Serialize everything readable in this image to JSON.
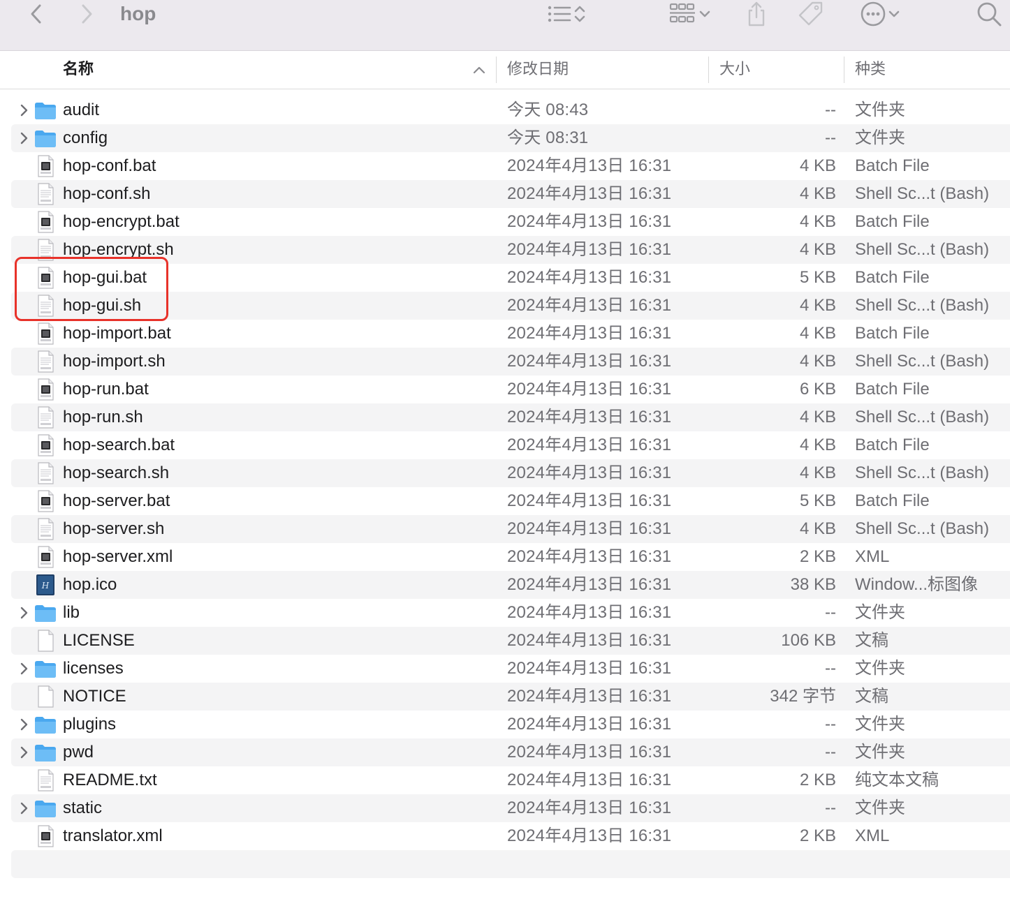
{
  "window": {
    "title": "hop"
  },
  "toolbar": {
    "icons": [
      "chevron-left-icon",
      "chevron-right-icon",
      "list-view-icon",
      "sort-updown-icon",
      "grid-view-icon",
      "chevron-down-icon",
      "share-icon",
      "tag-icon",
      "more-icon",
      "chevron-down-icon",
      "search-icon"
    ]
  },
  "columns": {
    "name": "名称",
    "date": "修改日期",
    "size": "大小",
    "kind": "种类"
  },
  "highlight_color": "#e8322a",
  "folder_color": "#4aa8ef",
  "files": [
    {
      "name": "audit",
      "date": "今天 08:43",
      "size": "--",
      "kind": "文件夹",
      "type": "folder"
    },
    {
      "name": "config",
      "date": "今天 08:31",
      "size": "--",
      "kind": "文件夹",
      "type": "folder"
    },
    {
      "name": "hop-conf.bat",
      "date": "2024年4月13日 16:31",
      "size": "4 KB",
      "kind": "Batch File",
      "type": "batch"
    },
    {
      "name": "hop-conf.sh",
      "date": "2024年4月13日 16:31",
      "size": "4 KB",
      "kind": "Shell Sc...t (Bash)",
      "type": "shell"
    },
    {
      "name": "hop-encrypt.bat",
      "date": "2024年4月13日 16:31",
      "size": "4 KB",
      "kind": "Batch File",
      "type": "batch"
    },
    {
      "name": "hop-encrypt.sh",
      "date": "2024年4月13日 16:31",
      "size": "4 KB",
      "kind": "Shell Sc...t (Bash)",
      "type": "shell"
    },
    {
      "name": "hop-gui.bat",
      "date": "2024年4月13日 16:31",
      "size": "5 KB",
      "kind": "Batch File",
      "type": "batch"
    },
    {
      "name": "hop-gui.sh",
      "date": "2024年4月13日 16:31",
      "size": "4 KB",
      "kind": "Shell Sc...t (Bash)",
      "type": "shell"
    },
    {
      "name": "hop-import.bat",
      "date": "2024年4月13日 16:31",
      "size": "4 KB",
      "kind": "Batch File",
      "type": "batch"
    },
    {
      "name": "hop-import.sh",
      "date": "2024年4月13日 16:31",
      "size": "4 KB",
      "kind": "Shell Sc...t (Bash)",
      "type": "shell"
    },
    {
      "name": "hop-run.bat",
      "date": "2024年4月13日 16:31",
      "size": "6 KB",
      "kind": "Batch File",
      "type": "batch"
    },
    {
      "name": "hop-run.sh",
      "date": "2024年4月13日 16:31",
      "size": "4 KB",
      "kind": "Shell Sc...t (Bash)",
      "type": "shell"
    },
    {
      "name": "hop-search.bat",
      "date": "2024年4月13日 16:31",
      "size": "4 KB",
      "kind": "Batch File",
      "type": "batch"
    },
    {
      "name": "hop-search.sh",
      "date": "2024年4月13日 16:31",
      "size": "4 KB",
      "kind": "Shell Sc...t (Bash)",
      "type": "shell"
    },
    {
      "name": "hop-server.bat",
      "date": "2024年4月13日 16:31",
      "size": "5 KB",
      "kind": "Batch File",
      "type": "batch"
    },
    {
      "name": "hop-server.sh",
      "date": "2024年4月13日 16:31",
      "size": "4 KB",
      "kind": "Shell Sc...t (Bash)",
      "type": "shell"
    },
    {
      "name": "hop-server.xml",
      "date": "2024年4月13日 16:31",
      "size": "2 KB",
      "kind": "XML",
      "type": "xml"
    },
    {
      "name": "hop.ico",
      "date": "2024年4月13日 16:31",
      "size": "38 KB",
      "kind": "Window...标图像",
      "type": "ico"
    },
    {
      "name": "lib",
      "date": "2024年4月13日 16:31",
      "size": "--",
      "kind": "文件夹",
      "type": "folder"
    },
    {
      "name": "LICENSE",
      "date": "2024年4月13日 16:31",
      "size": "106 KB",
      "kind": "文稿",
      "type": "doc"
    },
    {
      "name": "licenses",
      "date": "2024年4月13日 16:31",
      "size": "--",
      "kind": "文件夹",
      "type": "folder"
    },
    {
      "name": "NOTICE",
      "date": "2024年4月13日 16:31",
      "size": "342 字节",
      "kind": "文稿",
      "type": "doc"
    },
    {
      "name": "plugins",
      "date": "2024年4月13日 16:31",
      "size": "--",
      "kind": "文件夹",
      "type": "folder"
    },
    {
      "name": "pwd",
      "date": "2024年4月13日 16:31",
      "size": "--",
      "kind": "文件夹",
      "type": "folder"
    },
    {
      "name": "README.txt",
      "date": "2024年4月13日 16:31",
      "size": "2 KB",
      "kind": "纯文本文稿",
      "type": "txt"
    },
    {
      "name": "static",
      "date": "2024年4月13日 16:31",
      "size": "--",
      "kind": "文件夹",
      "type": "folder"
    },
    {
      "name": "translator.xml",
      "date": "2024年4月13日 16:31",
      "size": "2 KB",
      "kind": "XML",
      "type": "xml"
    }
  ]
}
